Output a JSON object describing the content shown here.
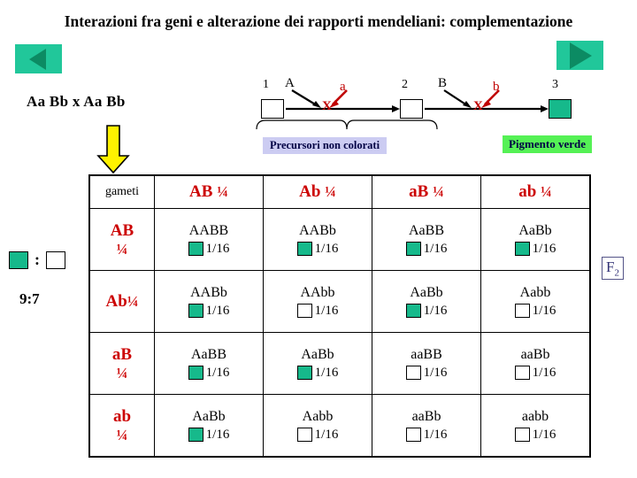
{
  "title": "Interazioni fra geni e alterazione dei rapporti mendeliani: complementazione",
  "nav": {
    "prev_label": "prev-slide",
    "next_label": "next-slide"
  },
  "cross": {
    "text": "Aa Bb x Aa Bb"
  },
  "pathway": {
    "steps": [
      {
        "number": "1",
        "filled": false
      },
      {
        "number": "2",
        "filled": false
      },
      {
        "number": "3",
        "filled": true
      }
    ],
    "enzymes": [
      {
        "wild": "A",
        "mutant": "a",
        "block": "X"
      },
      {
        "wild": "B",
        "mutant": "b",
        "block": "X"
      }
    ],
    "caption_precursors": "Precursori non colorati",
    "caption_pigment": "Pigmento verde"
  },
  "legend": {
    "colon": ":",
    "ratio": "9:7",
    "f2": "F",
    "f2_sub": "2"
  },
  "punnett": {
    "corner_label": "gameti",
    "col_headers": [
      {
        "gamete": "AB",
        "freq": "¼"
      },
      {
        "gamete": "Ab",
        "freq": "¼"
      },
      {
        "gamete": "aB",
        "freq": "¼"
      },
      {
        "gamete": "ab",
        "freq": "¼"
      }
    ],
    "row_headers": [
      {
        "gamete": "AB",
        "freq": "¼"
      },
      {
        "gamete": "Ab",
        "freq": "¼"
      },
      {
        "gamete": "aB",
        "freq": "¼"
      },
      {
        "gamete": "ab",
        "freq": "¼"
      }
    ],
    "rows": [
      [
        {
          "genotype": "AABB",
          "freq": "1/16",
          "green": true
        },
        {
          "genotype": "AABb",
          "freq": "1/16",
          "green": true
        },
        {
          "genotype": "AaBB",
          "freq": "1/16",
          "green": true
        },
        {
          "genotype": "AaBb",
          "freq": "1/16",
          "green": true
        }
      ],
      [
        {
          "genotype": "AABb",
          "freq": "1/16",
          "green": true
        },
        {
          "genotype": "AAbb",
          "freq": "1/16",
          "green": false
        },
        {
          "genotype": "AaBb",
          "freq": "1/16",
          "green": true
        },
        {
          "genotype": "Aabb",
          "freq": "1/16",
          "green": false
        }
      ],
      [
        {
          "genotype": "AaBB",
          "freq": "1/16",
          "green": true
        },
        {
          "genotype": "AaBb",
          "freq": "1/16",
          "green": true
        },
        {
          "genotype": "aaBB",
          "freq": "1/16",
          "green": false
        },
        {
          "genotype": "aaBb",
          "freq": "1/16",
          "green": false
        }
      ],
      [
        {
          "genotype": "AaBb",
          "freq": "1/16",
          "green": true
        },
        {
          "genotype": "Aabb",
          "freq": "1/16",
          "green": false
        },
        {
          "genotype": "aaBb",
          "freq": "1/16",
          "green": false
        },
        {
          "genotype": "aabb",
          "freq": "1/16",
          "green": false
        }
      ]
    ]
  },
  "colors": {
    "green_fill": "#16B98B",
    "nav_button": "#21C79A",
    "nav_triangle": "#0C8B63",
    "gamete_red": "#CC0000",
    "mutant_red": "#C00000",
    "precursor_bar": "#CCCCF2",
    "pigment_bar": "#55F155",
    "arrow_yellow": "#FFF200"
  }
}
